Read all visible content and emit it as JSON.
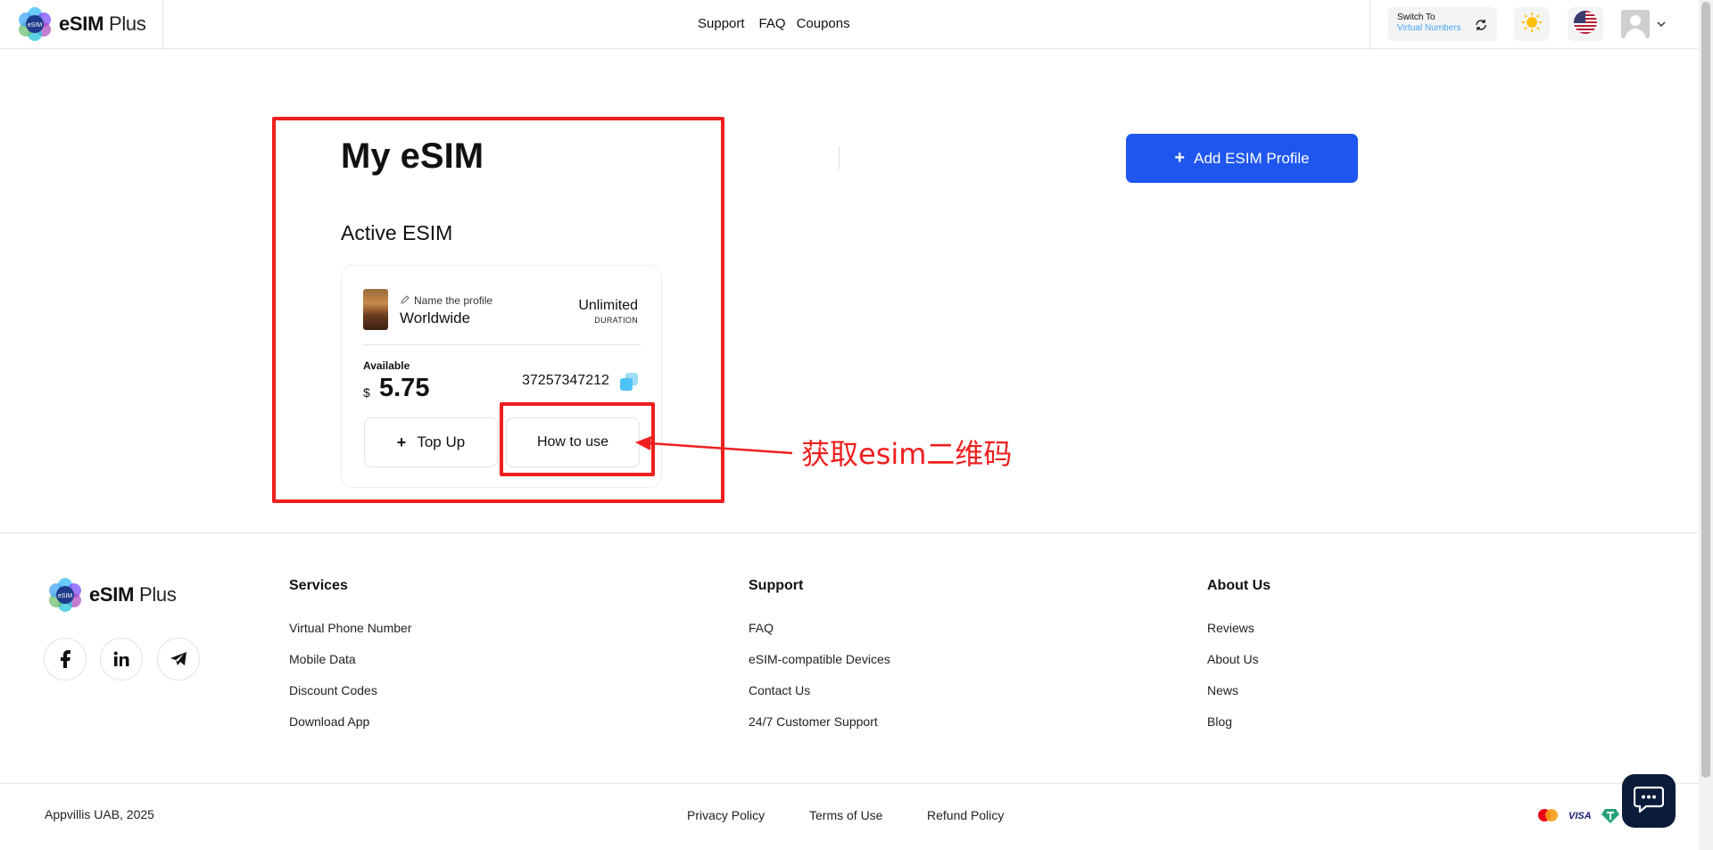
{
  "header": {
    "logo": {
      "badge": "eSIM",
      "brand": "eSIM",
      "brand_suffix": "Plus"
    },
    "nav": [
      "Support",
      "FAQ",
      "Coupons"
    ],
    "switch": {
      "line1": "Switch To",
      "line2": "Virtual Numbers"
    }
  },
  "main": {
    "title": "My eSIM",
    "section": "Active ESIM",
    "add_button": "Add ESIM Profile",
    "card": {
      "name_label": "Name the profile",
      "country": "Worldwide",
      "duration_value": "Unlimited",
      "duration_label": "DURATION",
      "available_label": "Available",
      "currency": "$",
      "balance": "5.75",
      "iccid": "37257347212",
      "topup_label": "Top Up",
      "howto_label": "How to use"
    }
  },
  "annotation": {
    "text": "获取esim二维码",
    "color": "#ef1f1f"
  },
  "footer": {
    "logo": {
      "brand": "eSIM",
      "brand_suffix": "Plus"
    },
    "social": [
      "facebook-icon",
      "linkedin-icon",
      "telegram-icon"
    ],
    "columns": [
      {
        "title": "Services",
        "links": [
          "Virtual Phone Number",
          "Mobile Data",
          "Discount Codes",
          "Download App"
        ]
      },
      {
        "title": "Support",
        "links": [
          "FAQ",
          "eSIM-compatible Devices",
          "Contact Us",
          "24/7 Customer Support"
        ]
      },
      {
        "title": "About Us",
        "links": [
          "Reviews",
          "About Us",
          "News",
          "Blog"
        ]
      }
    ],
    "copyright": "Appvillis UAB, 2025",
    "legal": [
      "Privacy Policy",
      "Terms of Use",
      "Refund Policy"
    ],
    "payments": [
      "mastercard-icon",
      "visa-icon",
      "tether-icon"
    ],
    "visa_text": "VISA"
  },
  "colors": {
    "accent": "#1f56f0",
    "annotation": "#ef1f1f",
    "chat": "#0b1b3a"
  }
}
